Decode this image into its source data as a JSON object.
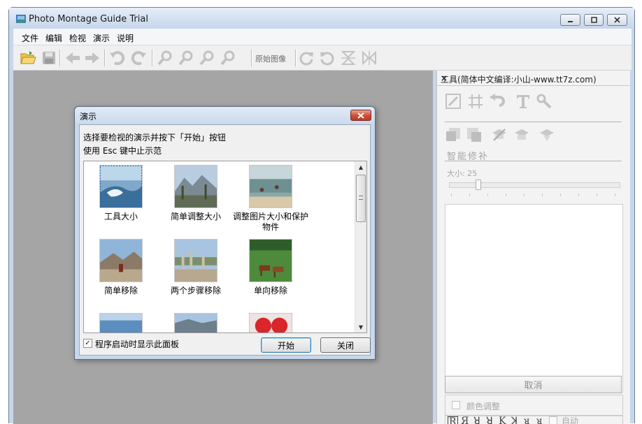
{
  "window": {
    "title": "Photo Montage Guide Trial"
  },
  "menu": [
    "文件",
    "编辑",
    "检视",
    "演示",
    "说明"
  ],
  "toolbar": {
    "original_image_label": "原始图像"
  },
  "right_panel": {
    "title": "工具(简体中文编译:小山-www.tt7z.com)",
    "close": "×",
    "section_heading": "智能修补",
    "size_label": "大小: 25",
    "size_value": 25,
    "cancel_label": "取消",
    "color_adjust_label": "颜色调整",
    "auto_label": "自动"
  },
  "dialog": {
    "title": "演示",
    "line1": "选择要检视的演示并按下「开始」按钮",
    "line2": "使用 Esc 键中止示范",
    "items": [
      {
        "label": "工具大小"
      },
      {
        "label": "简单调整大小"
      },
      {
        "label": "调整图片大小和保护物件"
      },
      {
        "label": "简单移除"
      },
      {
        "label": "两个步骤移除"
      },
      {
        "label": "单向移除"
      }
    ],
    "show_on_startup_label": "程序启动时显示此面板",
    "show_on_startup_checked": true,
    "check_mark": "✓",
    "start_label": "开始",
    "close_label": "关闭"
  },
  "colors": {
    "workspace": "#a5a5a5",
    "dialog_close": "#cf4c35",
    "title_bar": "#d3e0f0"
  }
}
